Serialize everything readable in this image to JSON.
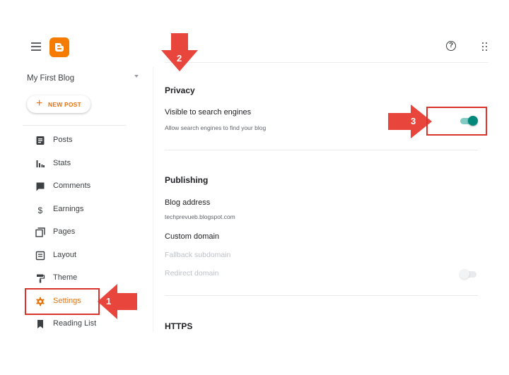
{
  "app": {
    "name": "Blogger"
  },
  "sidebar": {
    "blog_name": "My First Blog",
    "new_post_label": "NEW POST",
    "items": [
      {
        "label": "Posts",
        "icon": "posts-icon"
      },
      {
        "label": "Stats",
        "icon": "stats-icon"
      },
      {
        "label": "Comments",
        "icon": "comments-icon"
      },
      {
        "label": "Earnings",
        "icon": "dollar-icon"
      },
      {
        "label": "Pages",
        "icon": "pages-icon"
      },
      {
        "label": "Layout",
        "icon": "layout-icon"
      },
      {
        "label": "Theme",
        "icon": "paint-roller-icon"
      },
      {
        "label": "Settings",
        "icon": "gear-icon",
        "active": true
      },
      {
        "label": "Reading List",
        "icon": "bookmark-icon"
      }
    ]
  },
  "main": {
    "privacy": {
      "title": "Privacy",
      "visible_label": "Visible to search engines",
      "visible_desc": "Allow search engines to find your blog",
      "visible_enabled": true
    },
    "publishing": {
      "title": "Publishing",
      "blog_address_label": "Blog address",
      "blog_address_value": "techprevueb.blogspot.com",
      "custom_domain_label": "Custom domain",
      "fallback_subdomain_label": "Fallback subdomain",
      "redirect_domain_label": "Redirect domain",
      "redirect_enabled": false
    },
    "https": {
      "title": "HTTPS"
    }
  },
  "annotations": {
    "step1": "1",
    "step2": "2",
    "step3": "3"
  },
  "colors": {
    "accent": "#e8710a",
    "blogger_orange": "#f57c00",
    "toggle_on_thumb": "#00897b",
    "toggle_on_track": "#80cbc4",
    "annotation_red": "#e8453c",
    "annotation_border": "#d9342b"
  }
}
